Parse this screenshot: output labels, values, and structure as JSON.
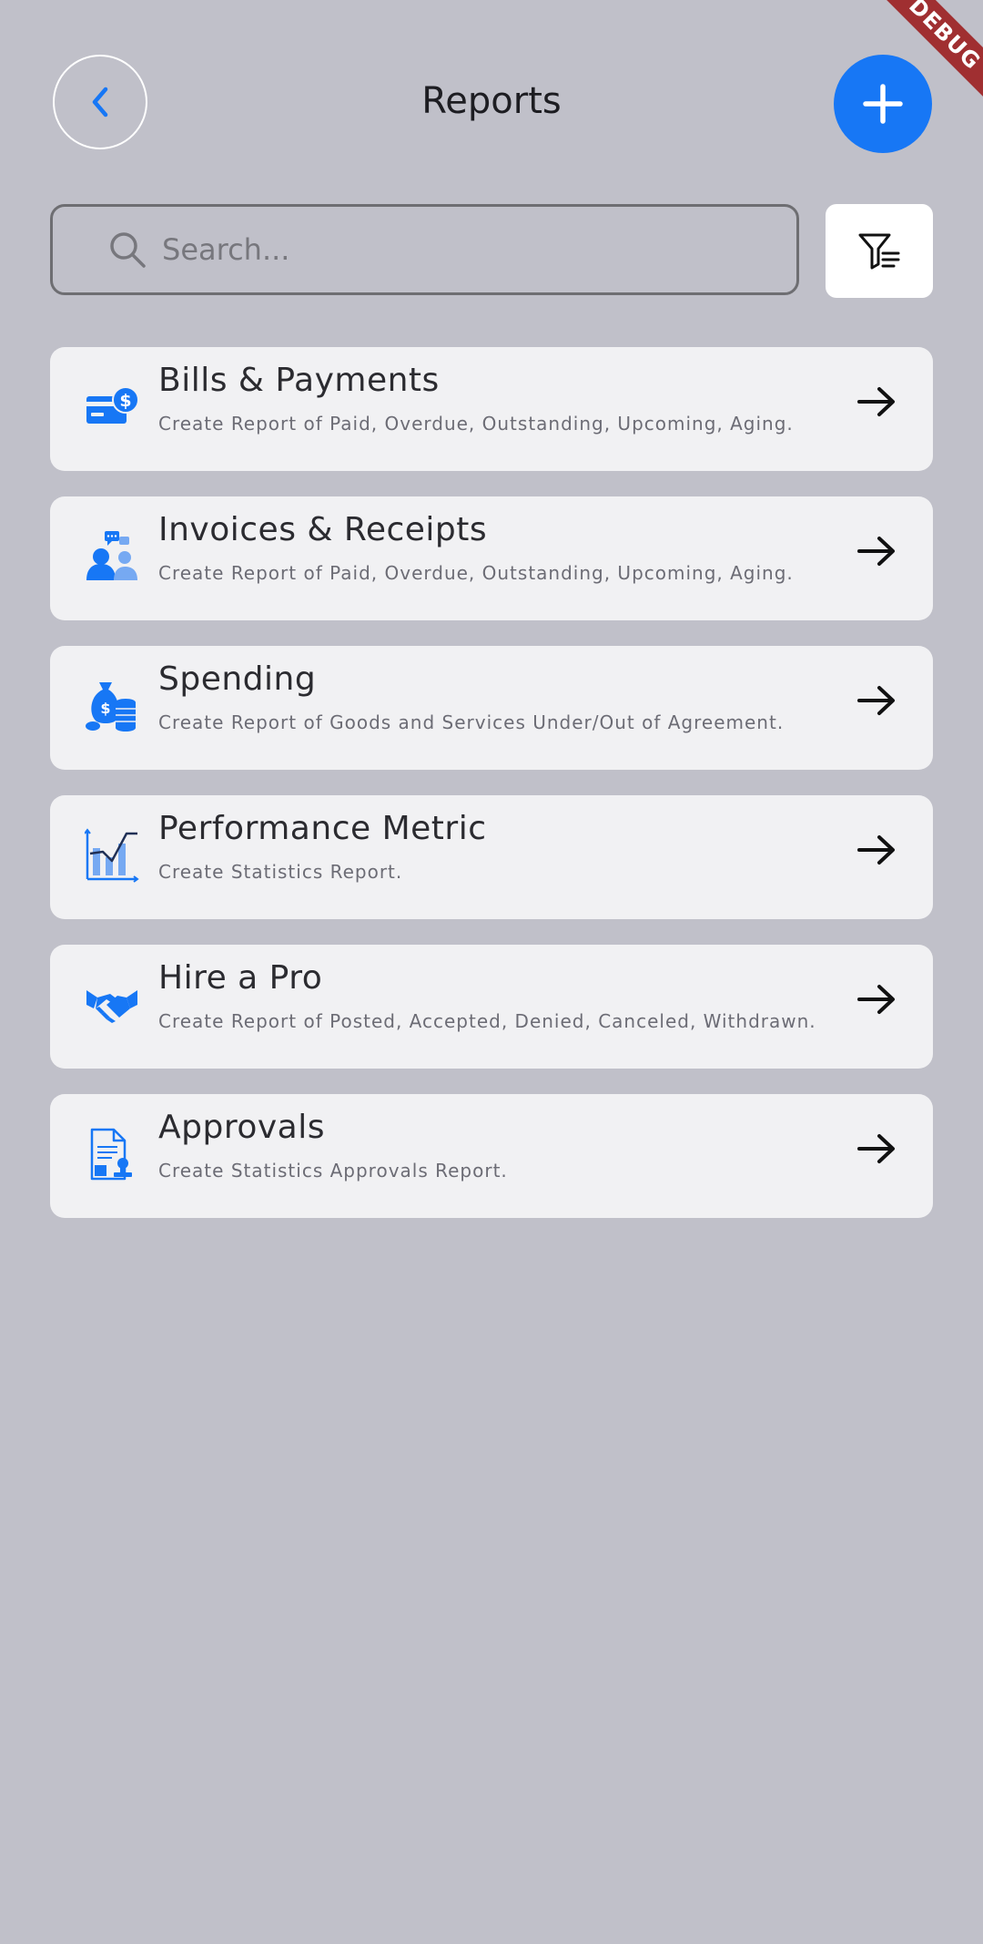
{
  "debug_banner": "DEBUG",
  "header": {
    "title": "Reports",
    "back_icon": "chevron-left-icon",
    "add_icon": "plus-icon"
  },
  "search": {
    "placeholder": "Search...",
    "value": "",
    "icon": "search-icon",
    "filter_icon": "filter-list-icon"
  },
  "colors": {
    "background": "#c0c0c9",
    "accent": "#1777f5",
    "card": "#f1f1f3"
  },
  "reports": [
    {
      "title": "Bills & Payments",
      "subtitle": "Create Report of Paid, Overdue, Outstanding, Upcoming, Aging.",
      "icon": "credit-card-dollar-icon"
    },
    {
      "title": "Invoices & Receipts",
      "subtitle": "Create Report of Paid, Overdue, Outstanding, Upcoming, Aging.",
      "icon": "people-chat-icon"
    },
    {
      "title": "Spending",
      "subtitle": "Create Report of Goods and Services Under/Out of Agreement.",
      "icon": "money-bag-coins-icon"
    },
    {
      "title": "Performance Metric",
      "subtitle": "Create Statistics Report.",
      "icon": "bar-chart-icon"
    },
    {
      "title": "Hire a Pro",
      "subtitle": "Create Report of Posted, Accepted, Denied, Canceled, Withdrawn.",
      "icon": "handshake-icon"
    },
    {
      "title": "Approvals",
      "subtitle": "Create Statistics Approvals Report.",
      "icon": "document-stamp-icon"
    }
  ]
}
